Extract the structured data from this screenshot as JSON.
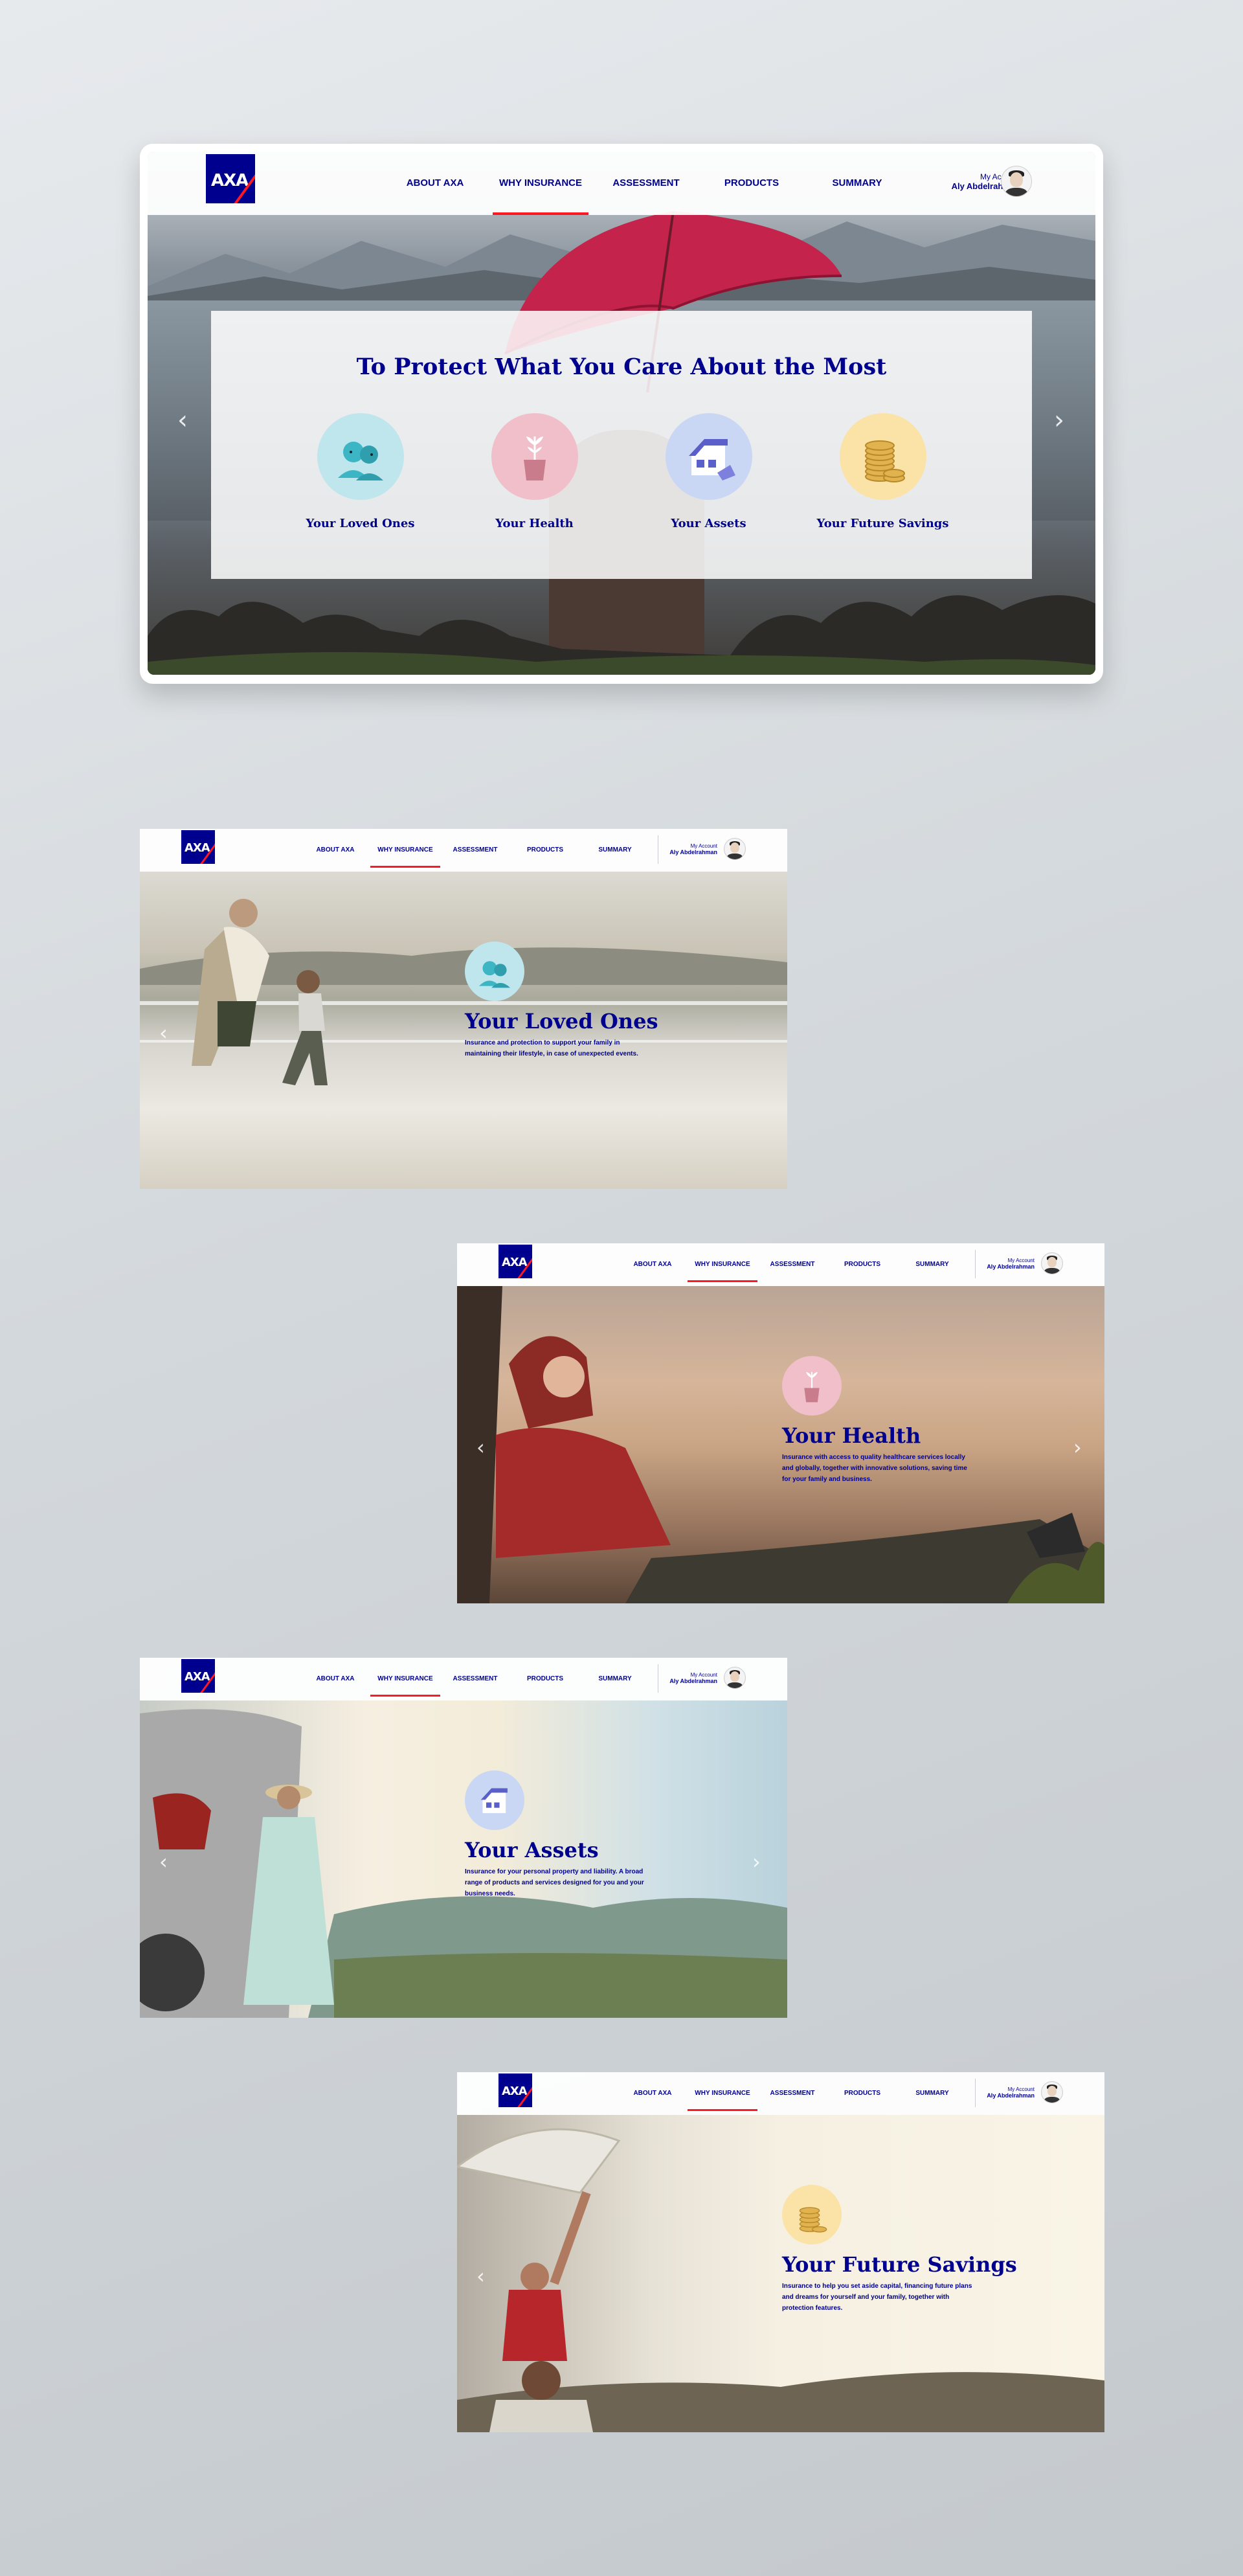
{
  "nav": {
    "logo_text": "AXA",
    "menu": [
      "ABOUT AXA",
      "WHY INSURANCE",
      "ASSESSMENT",
      "PRODUCTS",
      "SUMMARY"
    ],
    "active_index": 1,
    "account_label": "My Account",
    "account_name": "Aly Abdelrahman"
  },
  "hero": {
    "title": "To Protect What You Care About the Most",
    "features": [
      {
        "label": "Your Loved Ones",
        "icon": "family-icon",
        "color": "#bfe6ec"
      },
      {
        "label": "Your Health",
        "icon": "plant-pot-icon",
        "color": "#f0bfca"
      },
      {
        "label": "Your Assets",
        "icon": "house-icon",
        "color": "#c9d7f4"
      },
      {
        "label": "Your Future Savings",
        "icon": "coins-icon",
        "color": "#fbe3a8"
      }
    ]
  },
  "slides": [
    {
      "title": "Your Loved Ones",
      "description": "Insurance and protection to support your family in maintaining their lifestyle, in case of unexpected events.",
      "icon": "family-icon",
      "color": "#bfe6ec"
    },
    {
      "title": "Your Health",
      "description": "Insurance with access to quality healthcare services locally and globally, together with innovative solutions, saving time for your family and business.",
      "icon": "plant-pot-icon",
      "color": "#f0bfca"
    },
    {
      "title": "Your Assets",
      "description": "Insurance for your personal property and liability. A broad range of products and services designed for you and your business needs.",
      "icon": "house-icon",
      "color": "#c9d7f4"
    },
    {
      "title": "Your Future Savings",
      "description": "Insurance to help you set aside capital, financing future plans and dreams for yourself and your family, together with protection features.",
      "icon": "coins-icon",
      "color": "#fbe3a8"
    }
  ],
  "colors": {
    "brand_blue": "#00008f",
    "brand_red": "#ff1721"
  }
}
